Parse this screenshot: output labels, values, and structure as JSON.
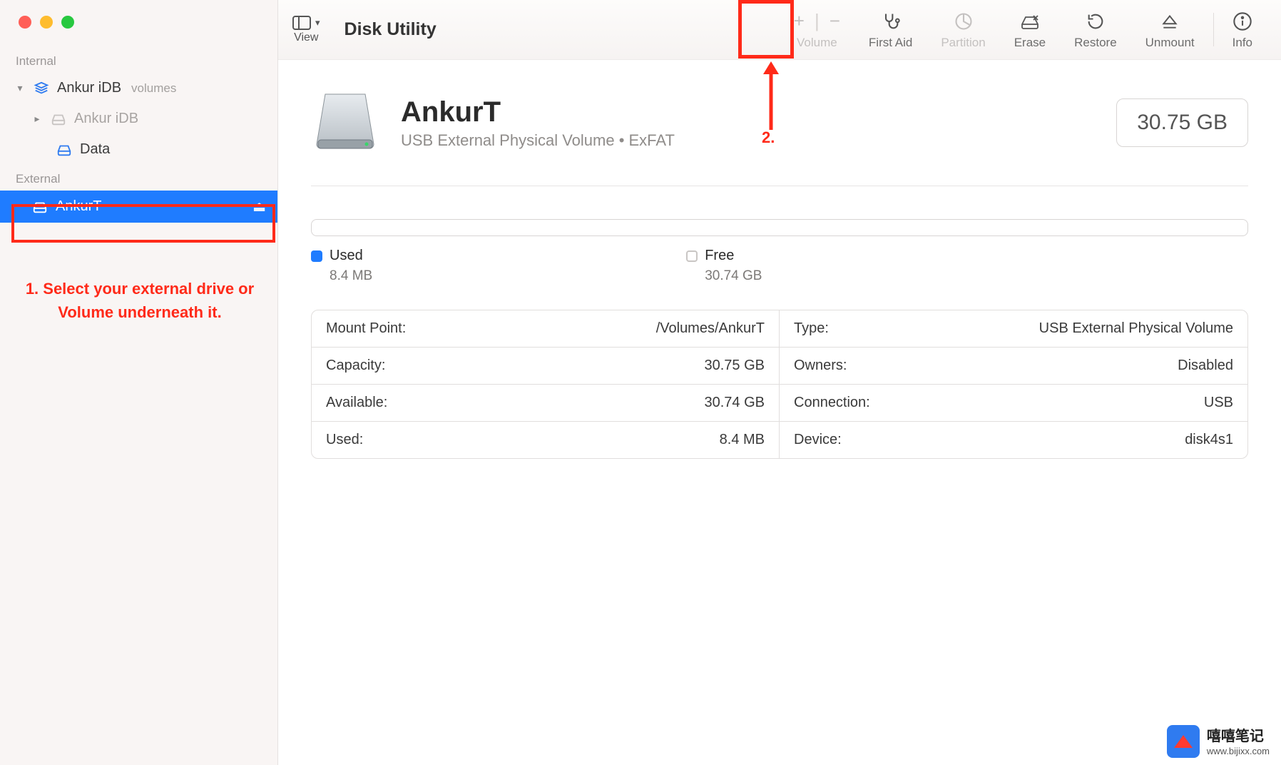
{
  "app_title": "Disk Utility",
  "toolbar": {
    "view": "View",
    "volume": "Volume",
    "first_aid": "First Aid",
    "partition": "Partition",
    "erase": "Erase",
    "restore": "Restore",
    "unmount": "Unmount",
    "info": "Info"
  },
  "sidebar": {
    "internal_label": "Internal",
    "external_label": "External",
    "items": [
      {
        "label": "Ankur iDB",
        "sub": "volumes"
      },
      {
        "label": "Ankur iDB"
      },
      {
        "label": "Data"
      },
      {
        "label": "AnkurT"
      }
    ]
  },
  "annotations": {
    "step1": "1. Select your external drive or Volume underneath it.",
    "step2": "2."
  },
  "volume": {
    "name": "AnkurT",
    "subtitle": "USB External Physical Volume • ExFAT",
    "size": "30.75 GB"
  },
  "legend": {
    "used_label": "Used",
    "used_value": "8.4 MB",
    "free_label": "Free",
    "free_value": "30.74 GB"
  },
  "info": [
    {
      "k": "Mount Point:",
      "v": "/Volumes/AnkurT"
    },
    {
      "k": "Type:",
      "v": "USB External Physical Volume"
    },
    {
      "k": "Capacity:",
      "v": "30.75 GB"
    },
    {
      "k": "Owners:",
      "v": "Disabled"
    },
    {
      "k": "Available:",
      "v": "30.74 GB"
    },
    {
      "k": "Connection:",
      "v": "USB"
    },
    {
      "k": "Used:",
      "v": "8.4 MB"
    },
    {
      "k": "Device:",
      "v": "disk4s1"
    }
  ],
  "watermark": {
    "name": "嘻嘻笔记",
    "url": "www.bijixx.com"
  }
}
